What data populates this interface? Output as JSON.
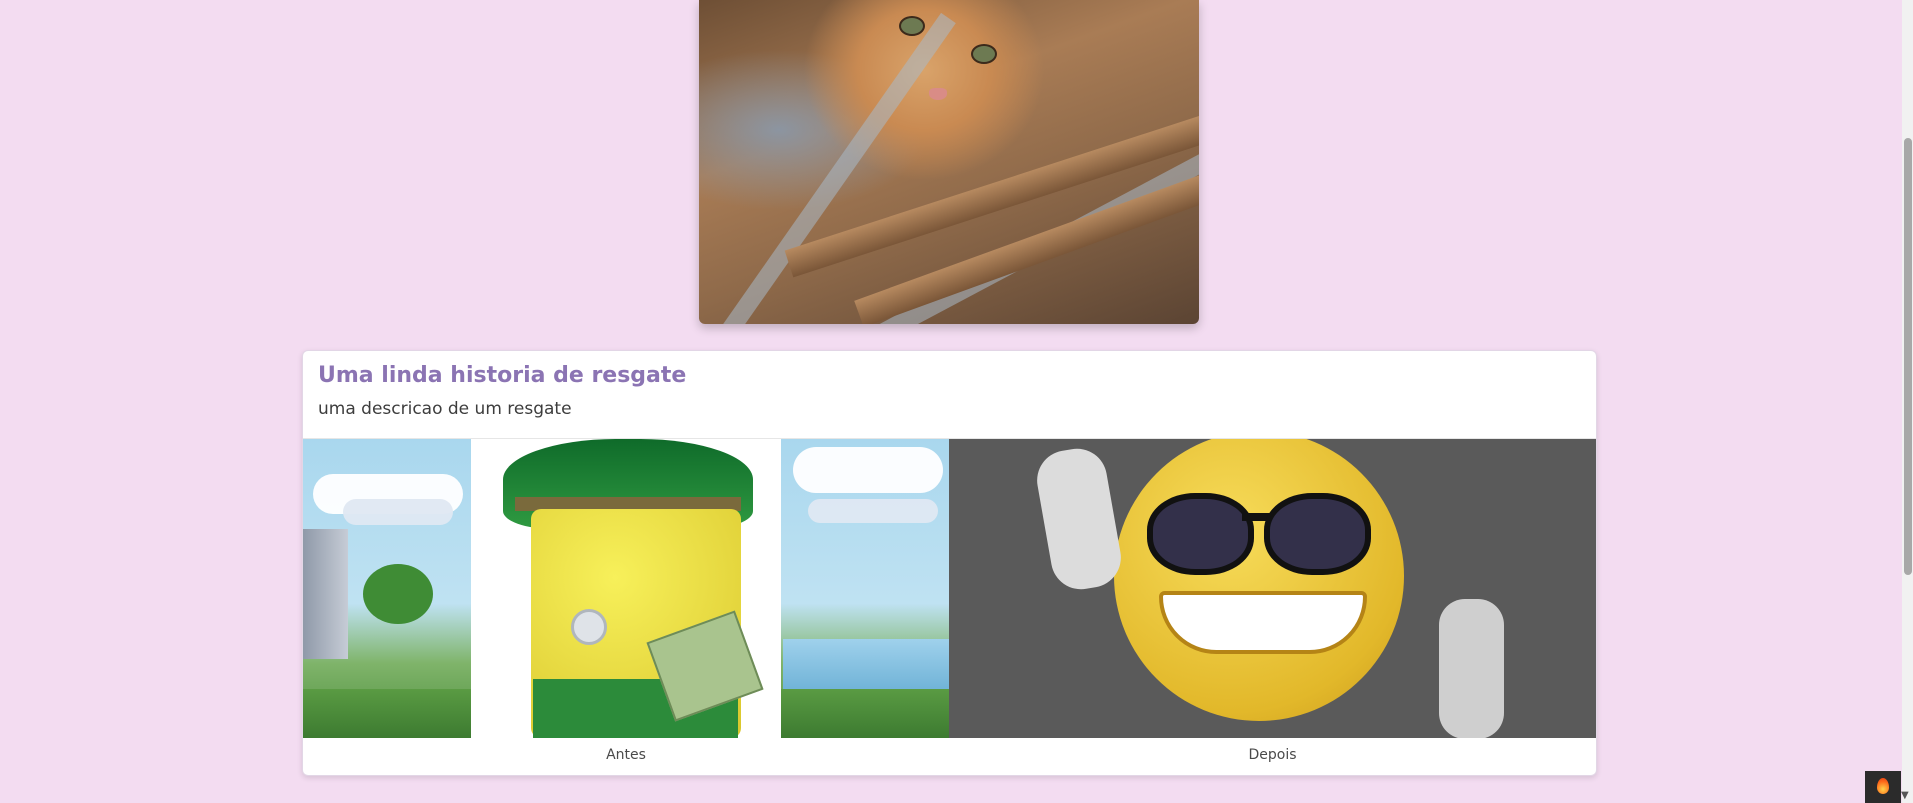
{
  "story": {
    "title": "Uma linda historia de resgate",
    "description": "uma descricao de um resgate",
    "before_label": "Antes",
    "after_label": "Depois"
  },
  "icons": {
    "badge": "flame-icon",
    "scroll_down": "chevron-down-icon"
  }
}
